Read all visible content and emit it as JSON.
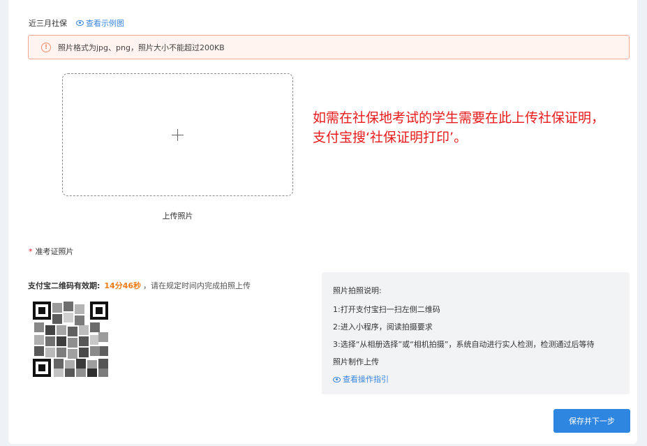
{
  "social_security": {
    "title": "近三月社保",
    "view_example": "查看示例图"
  },
  "alert": {
    "text": "照片格式为jpg、png，照片大小不能超过200KB"
  },
  "upload": {
    "label": "上传照片"
  },
  "annotation": {
    "text": "如需在社保地考试的学生需要在此上传社保证明，支付宝搜‘社保证明打印’。",
    "color": "#e8191b"
  },
  "admission_photo": {
    "required_mark": "*",
    "title": "准考证照片"
  },
  "qr": {
    "validity_label": "支付宝二维码有效期:",
    "countdown": "14分46秒",
    "hint": "，请在规定时间内完成拍照上传"
  },
  "instructions": {
    "heading": "照片拍照说明:",
    "steps": [
      "1:打开支付宝扫一扫左侧二维码",
      "2:进入小程序，阅读拍摄要求",
      "3:选择“从相册选择”或“相机拍摄”，系统自动进行实人检测，检测通过后等待",
      "照片制作上传"
    ],
    "guide_link": "查看操作指引"
  },
  "footer": {
    "save_next": "保存并下一步"
  },
  "colors": {
    "primary": "#2f86e0",
    "link": "#3a86e0",
    "countdown": "#f07b16",
    "alert_border": "#f4a892"
  }
}
